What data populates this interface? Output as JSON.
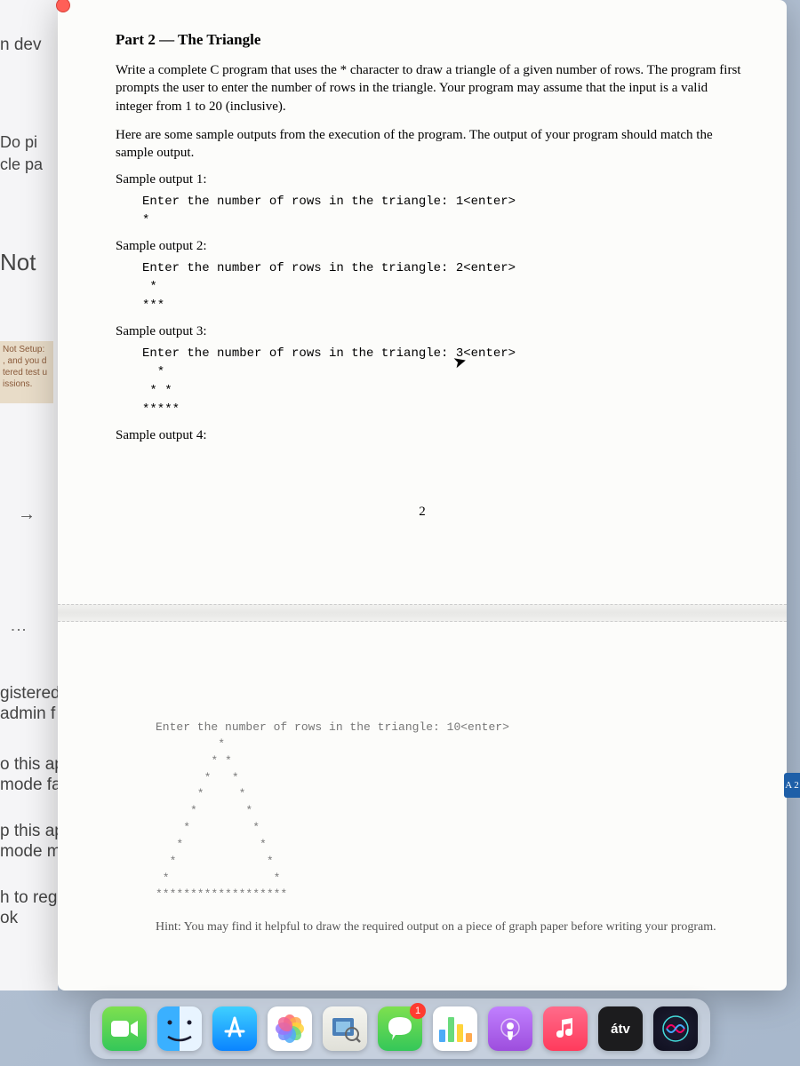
{
  "background": {
    "line1": "n dev",
    "line2": "Do pi",
    "line3": "cle pa",
    "line4": "Not",
    "notsetup": "Not Setup:\n, and you d\ntered test u\nissions.",
    "arrow": "→",
    "line5": "gistered",
    "line6": " admin f",
    "line7": "o this ap",
    "line8": "mode fa",
    "line9": "p this ap",
    "line10": " mode m",
    "line11": "h to regist",
    "line12": "ok"
  },
  "doc": {
    "heading": "Part 2 — The Triangle",
    "para1": "Write a complete C program that uses the * character to draw a triangle of a given number of rows. The program first prompts the user to enter the number of rows in the triangle. Your program may assume that the input is a valid integer from 1 to 20 (inclusive).",
    "para2": "Here are some sample outputs from the execution of the program. The output of your program should match the sample output.",
    "sample1_label": "Sample output 1:",
    "sample1_code": "Enter the number of rows in the triangle: 1<enter>\n*",
    "sample2_label": "Sample output 2:",
    "sample2_code": "Enter the number of rows in the triangle: 2<enter>\n *\n***",
    "sample3_label": "Sample output 3:",
    "sample3_code": "Enter the number of rows in the triangle: 3<enter>\n  *\n * *\n*****",
    "sample4_label": "Sample output 4:",
    "page_num": "2",
    "sample4_code": "Enter the number of rows in the triangle: 10<enter>\n         *\n        * *\n       *   *\n      *     *\n     *       *\n    *         *\n   *           *\n  *             *\n *               *\n*******************",
    "hint": "Hint: You may find it helpful to draw the required output on a piece of graph paper before writing your program."
  },
  "right_badge": "A 2",
  "dock": {
    "messages_badge": "1",
    "tv_label": "átv"
  }
}
